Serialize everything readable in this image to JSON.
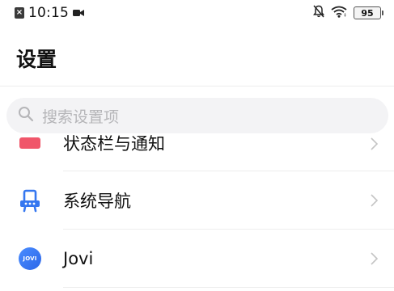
{
  "status_bar": {
    "sim_symbol": "×",
    "time": "10:15",
    "battery_level": "95"
  },
  "page": {
    "title": "设置"
  },
  "search": {
    "placeholder": "搜索设置项"
  },
  "list": {
    "items": [
      {
        "label": "状态栏与通知",
        "icon": "notification-icon",
        "color": "#f0566a"
      },
      {
        "label": "系统导航",
        "icon": "system-navigation-icon",
        "color": "#3577f0"
      },
      {
        "label": "Jovi",
        "icon": "jovi-icon",
        "icon_text": "JOVI",
        "color": "#3a7af5"
      }
    ]
  }
}
